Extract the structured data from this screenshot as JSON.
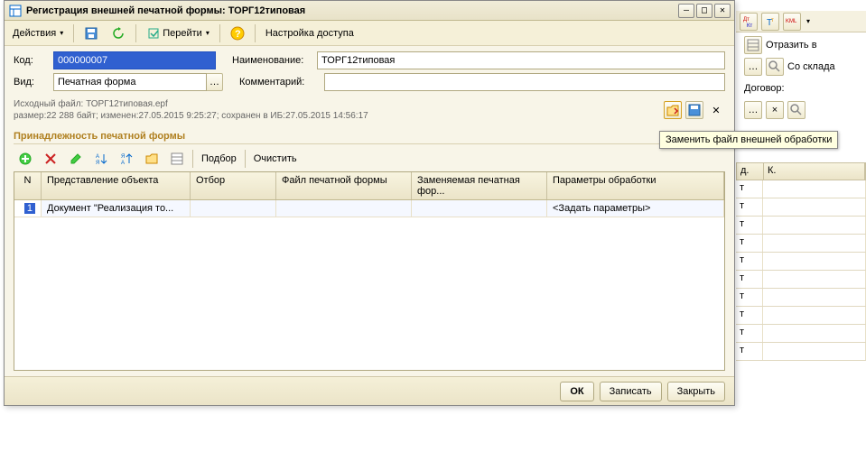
{
  "bg": {
    "toolbar_btns": [
      "ДтН Кт",
      "T",
      "KML"
    ],
    "right": [
      {
        "label": "Отразить в"
      },
      {
        "label": "Со склада"
      },
      {
        "label": "Договор:"
      }
    ],
    "table": {
      "headers": [
        "д.",
        "К."
      ],
      "rows": [
        "т",
        "т",
        "т",
        "т",
        "т",
        "т",
        "т",
        "т",
        "т",
        "т"
      ]
    }
  },
  "dialog": {
    "title": "Регистрация внешней печатной формы: ТОРГ12типовая",
    "toolbar": {
      "actions": "Действия",
      "goto": "Перейти",
      "access": "Настройка доступа"
    },
    "form": {
      "code_label": "Код:",
      "code_value": "000000007",
      "name_label": "Наименование:",
      "name_value": "ТОРГ12типовая",
      "type_label": "Вид:",
      "type_value": "Печатная форма",
      "comment_label": "Комментарий:",
      "comment_value": ""
    },
    "info": {
      "line1": "Исходный файл: ТОРГ12типовая.epf",
      "line2": "размер:22 288 байт; изменен:27.05.2015 9:25:27; сохранен в ИБ:27.05.2015 14:56:17"
    },
    "section_title": "Принадлежность печатной формы",
    "table_toolbar": {
      "select": "Подбор",
      "clear": "Очистить"
    },
    "table": {
      "headers": {
        "n": "N",
        "repr": "Представление объекта",
        "filter": "Отбор",
        "file": "Файл печатной формы",
        "repl": "Заменяемая печатная фор...",
        "params": "Параметры обработки"
      },
      "rows": [
        {
          "n": "1",
          "repr": "Документ \"Реализация то...",
          "filter": "",
          "file": "",
          "repl": "",
          "params": "<Задать параметры>"
        }
      ]
    },
    "footer": {
      "ok": "ОК",
      "write": "Записать",
      "close": "Закрыть"
    }
  },
  "tooltip": "Заменить файл внешней обработки"
}
